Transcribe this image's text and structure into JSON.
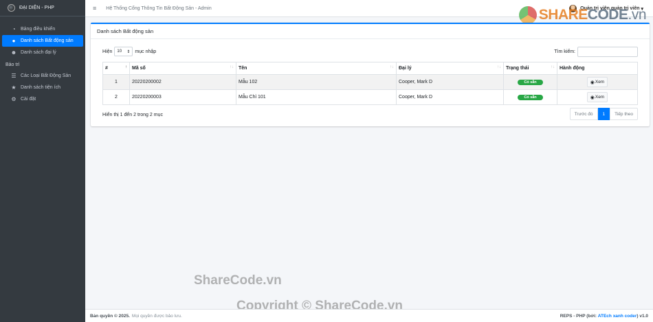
{
  "brand": {
    "name": "ĐẠI DIỆN - PHP"
  },
  "sidebar": {
    "items": [
      {
        "label": "Bảng điều khiển",
        "icon": "dashboard-icon",
        "active": false
      },
      {
        "label": "Danh sách Bất động sản",
        "icon": "map-marker-icon",
        "active": true
      },
      {
        "label": "Danh sách đại lý",
        "icon": "users-icon",
        "active": false
      }
    ],
    "section_header": "Bảo trì",
    "maintenance_items": [
      {
        "label": "Các Loại Bất Động Sản",
        "icon": "list-icon"
      },
      {
        "label": "Danh sách tiện ích",
        "icon": "star-icon"
      },
      {
        "label": "Cài đặt",
        "icon": "cogs-icon"
      }
    ]
  },
  "topbar": {
    "title": "Hệ Thống Cổng Thông Tin Bất Động Sản - Admin",
    "user_label": "Quản trị viên quản trị viên"
  },
  "card": {
    "title": "Danh sách Bất động sản",
    "show_prefix": "Hiện",
    "page_length": "10",
    "show_suffix": "mục nhập",
    "search_label": "Tìm kiếm:",
    "search_value": ""
  },
  "table": {
    "headers": [
      "#",
      "Mã số",
      "Tên",
      "Đại lý",
      "Trạng thái",
      "Hành động"
    ],
    "rows": [
      {
        "index": "1",
        "code": "20220200002",
        "name": "Mẫu 102",
        "agent": "Cooper, Mark D",
        "status": "Có sẵn",
        "action": "Xem"
      },
      {
        "index": "2",
        "code": "20220200003",
        "name": "Mẫu Chỉ 101",
        "agent": "Cooper, Mark D",
        "status": "Có sẵn",
        "action": "Xem"
      }
    ]
  },
  "pagination": {
    "info": "Hiển thị 1 đến 2 trong 2 mục",
    "prev": "Trước đó",
    "current": "1",
    "next": "Tiếp theo"
  },
  "footer": {
    "copyright_bold": "Bản quyền © 2025.",
    "copyright_rest": "Mọi quyền được bảo lưu.",
    "right_prefix": "REPS - PHP (bởi:",
    "right_link": "ATEch xanh coder",
    "right_suffix": ") v1.0"
  },
  "watermarks": {
    "logo_text_a": "SHARE",
    "logo_text_b": "CODE",
    "logo_text_c": ".vn",
    "line1": "ShareCode.vn",
    "line2": "Copyright © ShareCode.vn"
  },
  "colors": {
    "primary": "#007bff",
    "sidebar": "#343a40",
    "success": "#28a745"
  }
}
